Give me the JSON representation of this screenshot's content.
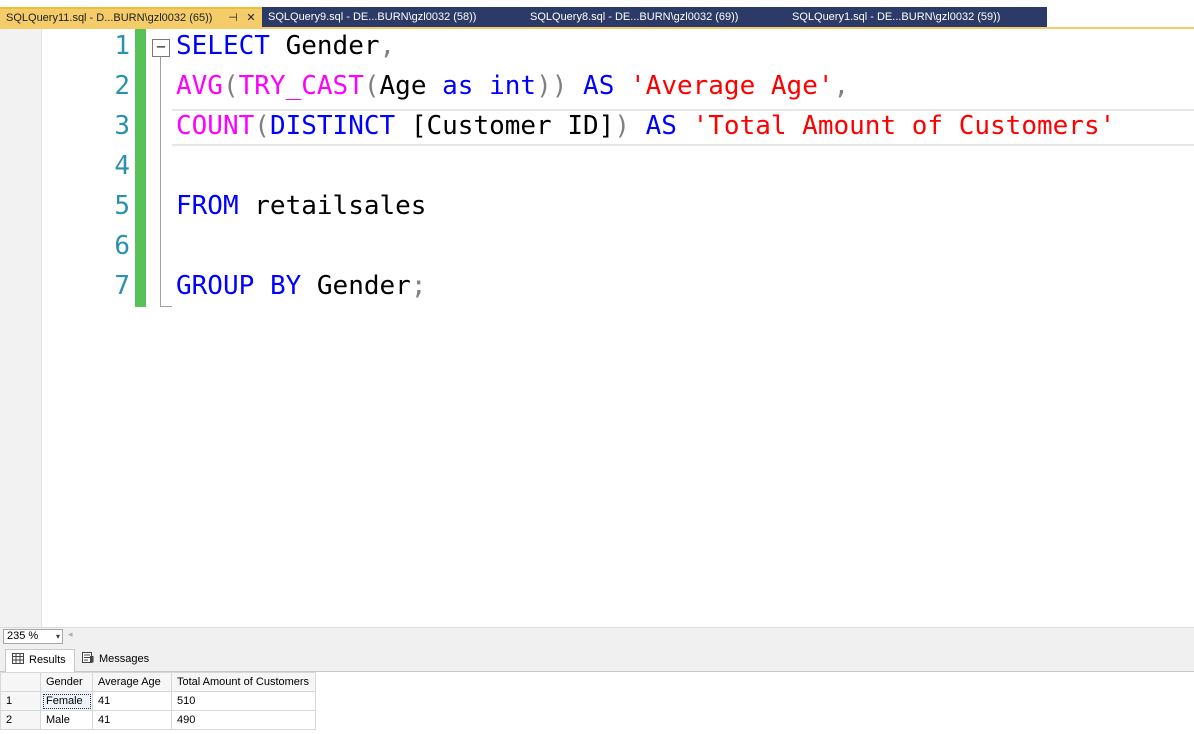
{
  "tabs": [
    {
      "label": "SQLQuery11.sql - D...BURN\\gzl0032 (65))",
      "active": true
    },
    {
      "label": "SQLQuery9.sql - DE...BURN\\gzl0032 (58))",
      "active": false
    },
    {
      "label": "SQLQuery8.sql - DE...BURN\\gzl0032 (69))",
      "active": false
    },
    {
      "label": "SQLQuery1.sql - DE...BURN\\gzl0032 (59))",
      "active": false
    }
  ],
  "tab_pin_glyph": "⊣",
  "tab_close_glyph": "✕",
  "editor": {
    "line_numbers": [
      "1",
      "2",
      "3",
      "4",
      "5",
      "6",
      "7"
    ],
    "fold_glyph": "−",
    "line1": {
      "kw_select": "SELECT",
      "id_gender": " Gender",
      "op_comma": ","
    },
    "line2": {
      "fn_avg": "AVG",
      "op_open1": "(",
      "fn_trycast": "TRY_CAST",
      "op_open2": "(",
      "id_age": "Age",
      "sp1": " ",
      "kw_as": "as",
      "sp2": " ",
      "kw_int": "int",
      "op_close": "))",
      "sp3": " ",
      "kw_as2": "AS",
      "sp4": " ",
      "str_avg": "'Average Age'",
      "op_comma": ","
    },
    "line3": {
      "fn_count": "COUNT",
      "op_open": "(",
      "kw_distinct": "DISTINCT",
      "id_custid": " [Customer ID]",
      "op_close": ")",
      "sp1": " ",
      "kw_as": "AS",
      "sp2": " ",
      "str_total": "'Total Amount of Customers'"
    },
    "line5": {
      "kw_from": "FROM",
      "id_table": " retailsales"
    },
    "line7": {
      "kw_group": "GROUP",
      "sp1": " ",
      "kw_by": "BY",
      "id_gender": " Gender",
      "op_semi": ";"
    }
  },
  "zoom": {
    "value": "235 %",
    "arrow": "▾",
    "scroll_left": "◂"
  },
  "result_tabs": {
    "results": "Results",
    "messages": "Messages"
  },
  "grid": {
    "columns": [
      "Gender",
      "Average Age",
      "Total Amount of Customers"
    ],
    "rows": [
      {
        "num": "1",
        "gender": "Female",
        "avg_age": "41",
        "total": "510"
      },
      {
        "num": "2",
        "gender": "Male",
        "avg_age": "41",
        "total": "490"
      }
    ]
  },
  "colors": {
    "keyword": "#0000ff",
    "function": "#ff00ff",
    "string": "#ff0000",
    "operator": "#808080",
    "line_number": "#2b91af",
    "change_bar": "#57c356",
    "active_tab": "#f5cc6a",
    "tab_strip": "#2b3a66"
  }
}
